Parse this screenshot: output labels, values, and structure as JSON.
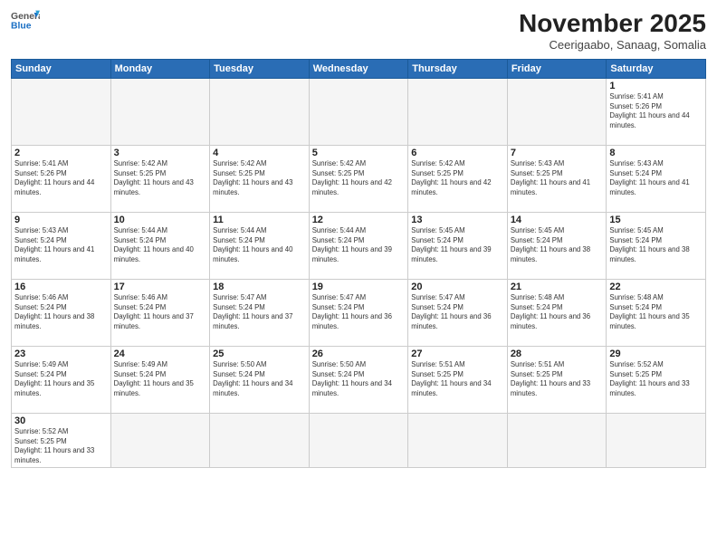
{
  "header": {
    "logo_general": "General",
    "logo_blue": "Blue",
    "month_title": "November 2025",
    "location": "Ceerigaabo, Sanaag, Somalia"
  },
  "weekdays": [
    "Sunday",
    "Monday",
    "Tuesday",
    "Wednesday",
    "Thursday",
    "Friday",
    "Saturday"
  ],
  "weeks": [
    [
      {
        "day": "",
        "info": ""
      },
      {
        "day": "",
        "info": ""
      },
      {
        "day": "",
        "info": ""
      },
      {
        "day": "",
        "info": ""
      },
      {
        "day": "",
        "info": ""
      },
      {
        "day": "",
        "info": ""
      },
      {
        "day": "1",
        "info": "Sunrise: 5:41 AM\nSunset: 5:26 PM\nDaylight: 11 hours and 44 minutes."
      }
    ],
    [
      {
        "day": "2",
        "info": "Sunrise: 5:41 AM\nSunset: 5:26 PM\nDaylight: 11 hours and 44 minutes."
      },
      {
        "day": "3",
        "info": "Sunrise: 5:42 AM\nSunset: 5:25 PM\nDaylight: 11 hours and 43 minutes."
      },
      {
        "day": "4",
        "info": "Sunrise: 5:42 AM\nSunset: 5:25 PM\nDaylight: 11 hours and 43 minutes."
      },
      {
        "day": "5",
        "info": "Sunrise: 5:42 AM\nSunset: 5:25 PM\nDaylight: 11 hours and 42 minutes."
      },
      {
        "day": "6",
        "info": "Sunrise: 5:42 AM\nSunset: 5:25 PM\nDaylight: 11 hours and 42 minutes."
      },
      {
        "day": "7",
        "info": "Sunrise: 5:43 AM\nSunset: 5:25 PM\nDaylight: 11 hours and 41 minutes."
      },
      {
        "day": "8",
        "info": "Sunrise: 5:43 AM\nSunset: 5:24 PM\nDaylight: 11 hours and 41 minutes."
      }
    ],
    [
      {
        "day": "9",
        "info": "Sunrise: 5:43 AM\nSunset: 5:24 PM\nDaylight: 11 hours and 41 minutes."
      },
      {
        "day": "10",
        "info": "Sunrise: 5:44 AM\nSunset: 5:24 PM\nDaylight: 11 hours and 40 minutes."
      },
      {
        "day": "11",
        "info": "Sunrise: 5:44 AM\nSunset: 5:24 PM\nDaylight: 11 hours and 40 minutes."
      },
      {
        "day": "12",
        "info": "Sunrise: 5:44 AM\nSunset: 5:24 PM\nDaylight: 11 hours and 39 minutes."
      },
      {
        "day": "13",
        "info": "Sunrise: 5:45 AM\nSunset: 5:24 PM\nDaylight: 11 hours and 39 minutes."
      },
      {
        "day": "14",
        "info": "Sunrise: 5:45 AM\nSunset: 5:24 PM\nDaylight: 11 hours and 38 minutes."
      },
      {
        "day": "15",
        "info": "Sunrise: 5:45 AM\nSunset: 5:24 PM\nDaylight: 11 hours and 38 minutes."
      }
    ],
    [
      {
        "day": "16",
        "info": "Sunrise: 5:46 AM\nSunset: 5:24 PM\nDaylight: 11 hours and 38 minutes."
      },
      {
        "day": "17",
        "info": "Sunrise: 5:46 AM\nSunset: 5:24 PM\nDaylight: 11 hours and 37 minutes."
      },
      {
        "day": "18",
        "info": "Sunrise: 5:47 AM\nSunset: 5:24 PM\nDaylight: 11 hours and 37 minutes."
      },
      {
        "day": "19",
        "info": "Sunrise: 5:47 AM\nSunset: 5:24 PM\nDaylight: 11 hours and 36 minutes."
      },
      {
        "day": "20",
        "info": "Sunrise: 5:47 AM\nSunset: 5:24 PM\nDaylight: 11 hours and 36 minutes."
      },
      {
        "day": "21",
        "info": "Sunrise: 5:48 AM\nSunset: 5:24 PM\nDaylight: 11 hours and 36 minutes."
      },
      {
        "day": "22",
        "info": "Sunrise: 5:48 AM\nSunset: 5:24 PM\nDaylight: 11 hours and 35 minutes."
      }
    ],
    [
      {
        "day": "23",
        "info": "Sunrise: 5:49 AM\nSunset: 5:24 PM\nDaylight: 11 hours and 35 minutes."
      },
      {
        "day": "24",
        "info": "Sunrise: 5:49 AM\nSunset: 5:24 PM\nDaylight: 11 hours and 35 minutes."
      },
      {
        "day": "25",
        "info": "Sunrise: 5:50 AM\nSunset: 5:24 PM\nDaylight: 11 hours and 34 minutes."
      },
      {
        "day": "26",
        "info": "Sunrise: 5:50 AM\nSunset: 5:24 PM\nDaylight: 11 hours and 34 minutes."
      },
      {
        "day": "27",
        "info": "Sunrise: 5:51 AM\nSunset: 5:25 PM\nDaylight: 11 hours and 34 minutes."
      },
      {
        "day": "28",
        "info": "Sunrise: 5:51 AM\nSunset: 5:25 PM\nDaylight: 11 hours and 33 minutes."
      },
      {
        "day": "29",
        "info": "Sunrise: 5:52 AM\nSunset: 5:25 PM\nDaylight: 11 hours and 33 minutes."
      }
    ],
    [
      {
        "day": "30",
        "info": "Sunrise: 5:52 AM\nSunset: 5:25 PM\nDaylight: 11 hours and 33 minutes."
      },
      {
        "day": "",
        "info": ""
      },
      {
        "day": "",
        "info": ""
      },
      {
        "day": "",
        "info": ""
      },
      {
        "day": "",
        "info": ""
      },
      {
        "day": "",
        "info": ""
      },
      {
        "day": "",
        "info": ""
      }
    ]
  ]
}
